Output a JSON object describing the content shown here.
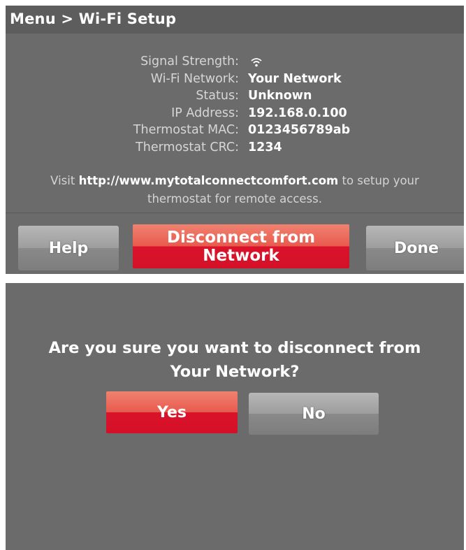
{
  "screen1": {
    "title": "Menu > Wi-Fi Setup",
    "info": [
      {
        "label": "Signal Strength:",
        "value": "",
        "icon": "wifi-signal-icon"
      },
      {
        "label": "Wi-Fi Network:",
        "value": "Your Network"
      },
      {
        "label": "Status:",
        "value": "Unknown"
      },
      {
        "label": "IP Address:",
        "value": "192.168.0.100"
      },
      {
        "label": "Thermostat MAC:",
        "value": "0123456789ab"
      },
      {
        "label": "Thermostat CRC:",
        "value": "1234"
      }
    ],
    "visit": {
      "prefix": "Visit ",
      "url": "http://www.mytotalconnectcomfort.com",
      "suffix_line1": " to setup your",
      "line2": "thermostat for remote access."
    },
    "buttons": {
      "help": "Help",
      "disconnect_line1": "Disconnect from",
      "disconnect_line2": "Network",
      "done": "Done"
    }
  },
  "screen2": {
    "question_line1": "Are you sure you want to disconnect from",
    "question_line2": "Your Network?",
    "buttons": {
      "yes": "Yes",
      "no": "No"
    }
  },
  "colors": {
    "background": "#6b6b6b",
    "accent_red": "#d9132a",
    "button_gray": "#9d9d9d",
    "text": "#ffffff"
  }
}
